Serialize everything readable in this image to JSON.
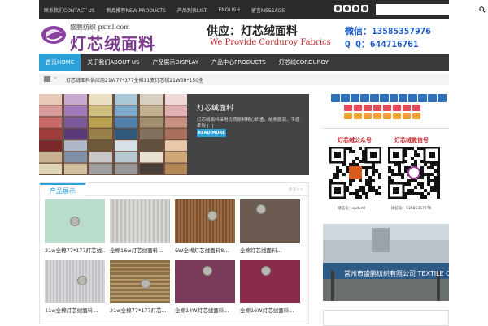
{
  "topnav": {
    "items": [
      "联系我们CONTACT US",
      "新品推荐NEW PRODUCTS",
      "产品列表LIST",
      "ENGLISH",
      "留言MESSAGE"
    ]
  },
  "search": {
    "placeholder": ""
  },
  "header": {
    "logo_small": "盛鹏纺织",
    "logo_domain": "pxml.com",
    "logo_title": "灯芯绒面料",
    "supply": "供应：灯芯绒面料",
    "provide": "We Provide Corduroy Fabrics",
    "wechat": "微信：13585357976",
    "qq": "Q Q：644716761"
  },
  "mainnav": {
    "items": [
      "首页HOME",
      "关于我们ABOUT US",
      "产品展示DISPLAY",
      "产品中心PRODUCTS",
      "灯芯绒CORDUROY"
    ],
    "active_index": 0
  },
  "breadcrumb": {
    "separator": "»",
    "text": "灯芯绒面料供应商21W77*177全棉11支灯芯绒21W58*150全"
  },
  "slider": {
    "title": "灯芯绒面料",
    "desc": "灯芯绒面料采用优质原料精心织造，绒条圆润，手感柔软 [..]",
    "button": "READ MORE"
  },
  "products": {
    "title": "产品展示",
    "more": "更多>>",
    "items": [
      {
        "name": "21w全棉77*177灯芯绒..."
      },
      {
        "name": "全棉16w灯芯绒面料..."
      },
      {
        "name": "6W全棉灯芯绒面料8..."
      },
      {
        "name": "全棉灯芯绒面料..."
      },
      {
        "name": "11w全棉灯芯绒面料..."
      },
      {
        "name": "21w全棉77*177灯芯..."
      },
      {
        "name": "全棉14W灯芯绒面料..."
      },
      {
        "name": "全棉16W灯芯绒面料..."
      }
    ]
  },
  "sidebar": {
    "qr_left_label": "灯芯绒公众号",
    "qr_right_label": "灯芯绒微信号",
    "qr_left_sub": "微信号：spdxml",
    "qr_right_sub": "微信号：13585357976",
    "factory_sign": "常州市盛鹏纺织有限公司 TEXTILE CO. LTD"
  },
  "colors": {
    "accent": "#2aa1d8",
    "topbar": "#2b2b2b",
    "nav": "#3a3a3a",
    "brand_purple": "#7a3c8d",
    "red": "#c6262e",
    "blue": "#1a57c7"
  }
}
